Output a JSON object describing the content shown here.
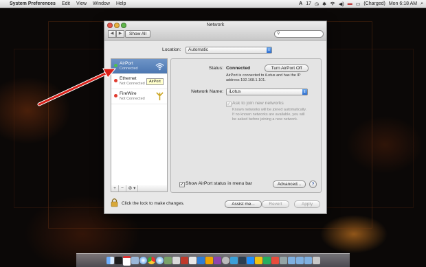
{
  "menubar": {
    "apple": "",
    "app": "System Preferences",
    "items": [
      "Edit",
      "View",
      "Window",
      "Help"
    ],
    "adobe_count": "17",
    "battery": "(Charged)",
    "clock": "Mon 6:18 AM"
  },
  "window": {
    "title": "Network",
    "show_all": "Show All",
    "search_placeholder": ""
  },
  "location": {
    "label": "Location:",
    "value": "Automatic"
  },
  "services": [
    {
      "name": "AirPort",
      "status": "Connected",
      "dot": "#4fbf4f",
      "icon": "wifi-icon"
    },
    {
      "name": "Ethernet",
      "status": "Not Connected",
      "dot": "#e03b2f",
      "icon": "ethernet-icon"
    },
    {
      "name": "FireWire",
      "status": "Not Connected",
      "dot": "#e03b2f",
      "icon": "firewire-icon"
    }
  ],
  "tooltip": "AirPort",
  "sidebar_footer": {
    "add": "+",
    "remove": "−",
    "gear": "⚙ ▾"
  },
  "detail": {
    "status_label": "Status:",
    "status_value": "Connected",
    "turn_off": "Turn AirPort Off",
    "status_desc": "AirPort is connected to iLotus and has the IP address 192.168.1.101.",
    "network_name_label": "Network Name:",
    "network_name": "iLotus",
    "ask_join": "Ask to join new networks",
    "ask_join_desc": "Known networks will be joined automatically. If no known networks are available, you will be asked before joining a new network.",
    "show_status": "Show AirPort status in menu bar",
    "advanced": "Advanced...",
    "help": "?"
  },
  "bottom": {
    "lock_text": "Click the lock to make changes.",
    "assist": "Assist me...",
    "revert": "Revert",
    "apply": "Apply"
  },
  "colors": {
    "select_blue": "#2f6fd1",
    "sidebar_selected": "#5a82bb"
  }
}
